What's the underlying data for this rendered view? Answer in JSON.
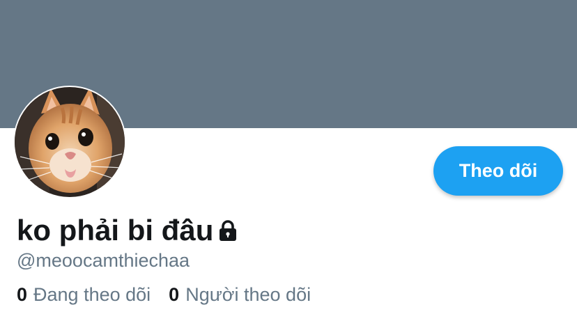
{
  "profile": {
    "display_name": "ko phải bi đâu",
    "handle": "@meoocamthiechaa",
    "protected_icon": "lock-icon",
    "avatar_icon": "cat-photo"
  },
  "actions": {
    "follow_label": "Theo dõi"
  },
  "stats": {
    "following_count": "0",
    "following_label": "Đang theo dõi",
    "followers_count": "0",
    "followers_label": "Người theo dõi"
  },
  "colors": {
    "banner": "#657786",
    "accent": "#1da1f2",
    "text_primary": "#14171a",
    "text_secondary": "#657786"
  }
}
